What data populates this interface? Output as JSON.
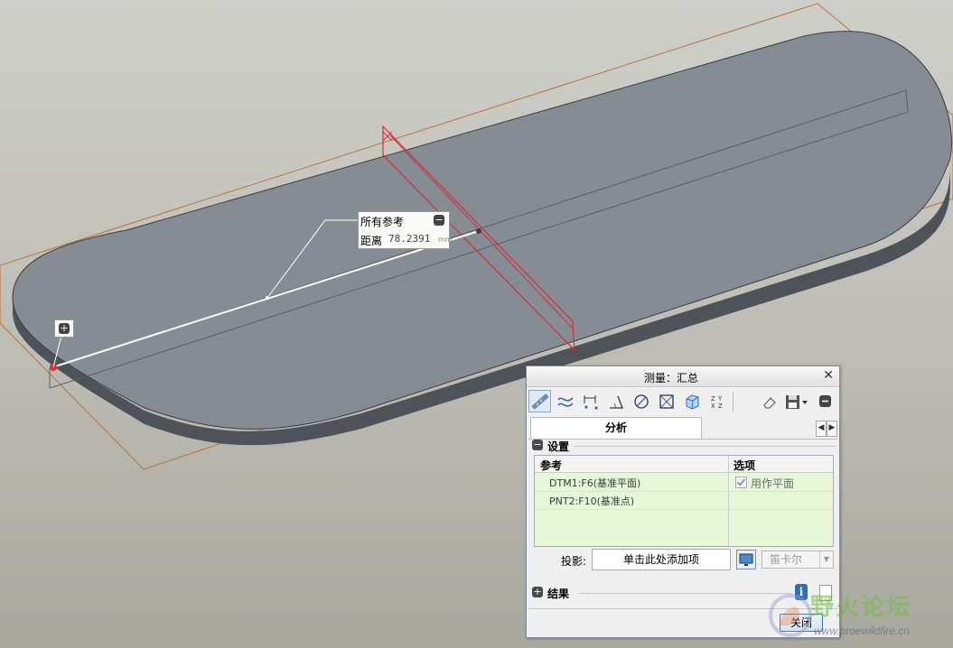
{
  "callout": {
    "title": "所有参考",
    "distance_label": "距离",
    "distance_value": "78.2391",
    "unit": "mm"
  },
  "dialog": {
    "title": "测量：汇总",
    "tab": "分析",
    "settings_label": "设置",
    "table": {
      "col_reference": "参考",
      "col_options": "选项",
      "rows": [
        {
          "reference": "DTM1:F6(基准平面)",
          "option": "用作平面"
        },
        {
          "reference": "PNT2:F10(基准点)",
          "option": ""
        }
      ]
    },
    "projection_label": "投影:",
    "projection_placeholder": "单击此处添加项",
    "coord_select": "笛卡尔",
    "results_label": "结果",
    "close_button": "关闭"
  },
  "watermark": {
    "text": "野火论坛",
    "url": "www.proewildfire.cn"
  },
  "colors": {
    "part_top": "#868c93",
    "part_side": "#4d5359",
    "datum_plane": "#d2303a",
    "bounding_box": "#b8733a",
    "dialog_border": "#7a8ea8"
  }
}
